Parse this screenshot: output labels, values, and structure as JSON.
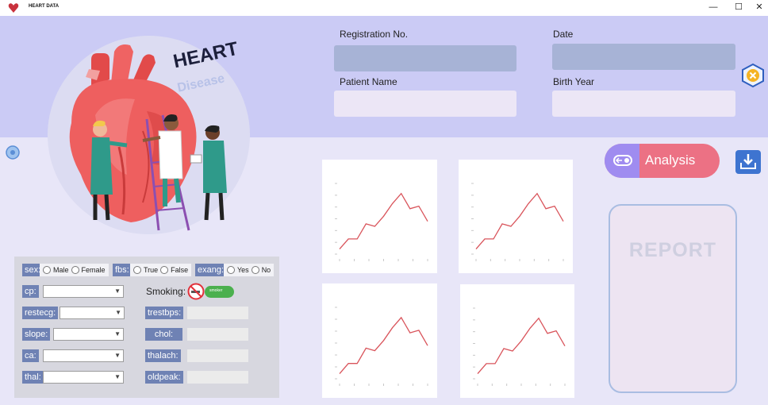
{
  "window": {
    "title": "HEART DATA",
    "controls": {
      "minimize": "—",
      "maximize": "☐",
      "close": "✕"
    }
  },
  "hero": {
    "heading": "HEART",
    "subheading": "Disease"
  },
  "patient": {
    "registration_label": "Registration No.",
    "registration_value": "",
    "date_label": "Date",
    "date_value": "",
    "name_label": "Patient Name",
    "name_value": "",
    "birth_year_label": "Birth Year",
    "birth_year_value": ""
  },
  "form": {
    "sex": {
      "label": "sex:",
      "options": [
        "Male",
        "Female"
      ]
    },
    "fbs": {
      "label": "fbs:",
      "options": [
        "True",
        "False"
      ]
    },
    "exang": {
      "label": "exang:",
      "options": [
        "Yes",
        "No"
      ]
    },
    "cp_label": "cp:",
    "restecg_label": "restecg:",
    "slope_label": "slope:",
    "ca_label": "ca:",
    "thal_label": "thal:",
    "smoking_label": "Smoking:",
    "smoking_toggle_label": "smoker",
    "trestbps_label": "trestbps:",
    "chol_label": "chol:",
    "thalach_label": "thalach:",
    "oldpeak_label": "oldpeak:"
  },
  "actions": {
    "analysis_label": "Analysis"
  },
  "report": {
    "title": "REPORT"
  },
  "colors": {
    "accent": "#ec7184",
    "accent_secondary": "#9f8cf0",
    "header": "#cbcbf5",
    "background": "#e8e6f8",
    "tag": "#6f82b4",
    "chart_line": "#d9545b"
  },
  "icons": [
    "heart-logo-icon",
    "close-hex-icon",
    "download-icon",
    "toggle-icon",
    "no-smoking-icon",
    "settings-knob-icon"
  ],
  "chart_data": [
    {
      "type": "line",
      "series": [
        {
          "values": [
            1,
            3,
            3,
            6,
            5.5,
            7.5,
            10,
            12,
            9,
            9.5,
            6.5
          ]
        }
      ]
    },
    {
      "type": "line",
      "series": [
        {
          "values": [
            1,
            3,
            3,
            6,
            5.5,
            7.5,
            10,
            12,
            9,
            9.5,
            6.5
          ]
        }
      ]
    },
    {
      "type": "line",
      "series": [
        {
          "values": [
            1,
            3,
            3,
            6,
            5.5,
            7.5,
            10,
            12,
            9,
            9.5,
            6.5
          ]
        }
      ]
    },
    {
      "type": "line",
      "series": [
        {
          "values": [
            1,
            3,
            3,
            6,
            5.5,
            7.5,
            10,
            12,
            9,
            9.5,
            6.5
          ]
        }
      ]
    }
  ]
}
